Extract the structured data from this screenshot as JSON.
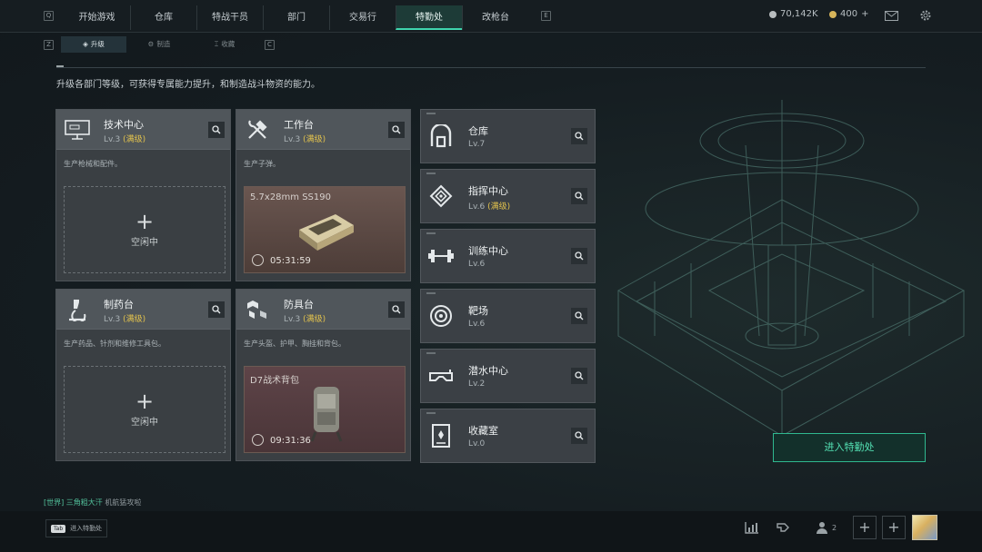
{
  "top_nav": {
    "left_key": "Q",
    "right_key": "E",
    "tabs": [
      "开始游戏",
      "仓库",
      "特战干员",
      "部门",
      "交易行",
      "特勤处",
      "改枪台"
    ],
    "active_tab": "特勤处"
  },
  "currency": {
    "silver": "70,142K",
    "gold": "400",
    "gold_add": "+"
  },
  "sub_nav": {
    "left_key": "Z",
    "right_key": "C",
    "tabs": [
      "升级",
      "制造",
      "收藏"
    ],
    "active_tab": "升级"
  },
  "description": "升级各部门等级，可获得专属能力提升，和制造战斗物资的能力。",
  "workshops": [
    {
      "title": "技术中心",
      "level": "Lv.3",
      "max": "(满级)",
      "desc": "生产枪械和配件。",
      "status": "idle",
      "idle_label": "空闲中",
      "icon": "monitor-icon"
    },
    {
      "title": "工作台",
      "level": "Lv.3",
      "max": "(满级)",
      "desc": "生产子弹。",
      "status": "producing",
      "item": "5.7x28mm SS190",
      "time": "05:31:59",
      "icon": "tools-icon"
    },
    {
      "title": "制药台",
      "level": "Lv.3",
      "max": "(满级)",
      "desc": "生产药品、针剂和维修工具包。",
      "status": "idle",
      "idle_label": "空闲中",
      "icon": "microscope-icon"
    },
    {
      "title": "防具台",
      "level": "Lv.3",
      "max": "(满级)",
      "desc": "生产头盔、护甲、胸挂和背包。",
      "status": "producing",
      "item": "D7战术背包",
      "time": "09:31:36",
      "icon": "cubes-icon"
    }
  ],
  "facilities": [
    {
      "title": "仓库",
      "level": "Lv.7",
      "max": "",
      "icon": "warehouse-icon"
    },
    {
      "title": "指挥中心",
      "level": "Lv.6",
      "max": "(满级)",
      "icon": "command-chip-icon"
    },
    {
      "title": "训练中心",
      "level": "Lv.6",
      "max": "",
      "icon": "dumbbell-icon"
    },
    {
      "title": "靶场",
      "level": "Lv.6",
      "max": "",
      "icon": "target-icon"
    },
    {
      "title": "潜水中心",
      "level": "Lv.2",
      "max": "",
      "icon": "diving-mask-icon"
    },
    {
      "title": "收藏室",
      "level": "Lv.0",
      "max": "",
      "icon": "collection-case-icon"
    }
  ],
  "enter_button": "进入特勤处",
  "chat": {
    "channel": "[世界]",
    "user": "三角粗大汗",
    "message": "机航猛攻啦"
  },
  "bottom": {
    "tab_key": "Tab",
    "tab_hint": "进入特勤处",
    "friends_count": "2"
  },
  "colors": {
    "accent": "#3fd5ae",
    "max_level": "#e2c24d",
    "production_bg": "#5a4743"
  }
}
